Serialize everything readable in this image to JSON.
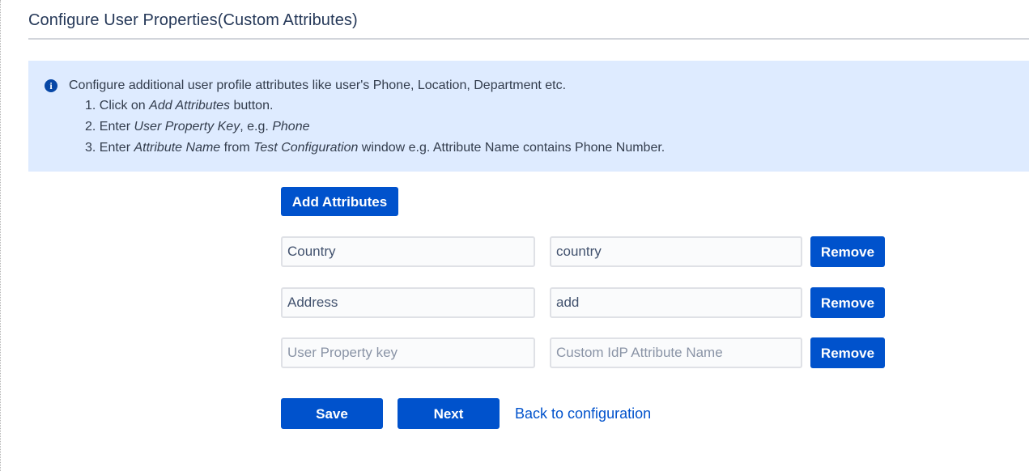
{
  "page": {
    "title": "Configure User Properties(Custom Attributes)"
  },
  "info": {
    "icon": "info-icon",
    "glyph": "i",
    "intro": "Configure additional user profile attributes like user's Phone, Location, Department etc.",
    "step1": {
      "a": "1. Click on ",
      "b": "Add Attributes",
      "c": " button."
    },
    "step2": {
      "a": "2. Enter ",
      "b": "User Property Key",
      "c": ", e.g. ",
      "d": "Phone"
    },
    "step3": {
      "a": "3. Enter ",
      "b": "Attribute Name",
      "c": " from ",
      "d": "Test Configuration",
      "e": " window e.g. Attribute Name contains Phone Number."
    }
  },
  "actions": {
    "add_label": "Add Attributes",
    "remove_label": "Remove",
    "save_label": "Save",
    "next_label": "Next",
    "back_label": "Back to configuration"
  },
  "attributes": [
    {
      "key": "Country",
      "value": "country"
    },
    {
      "key": "Address",
      "value": "add"
    },
    {
      "key": "",
      "value": "",
      "key_placeholder": "User Property key",
      "value_placeholder": "Custom IdP Attribute Name"
    }
  ],
  "colors": {
    "primary": "#0052cc",
    "info_bg": "#deebff",
    "info_icon": "#0747a6"
  }
}
